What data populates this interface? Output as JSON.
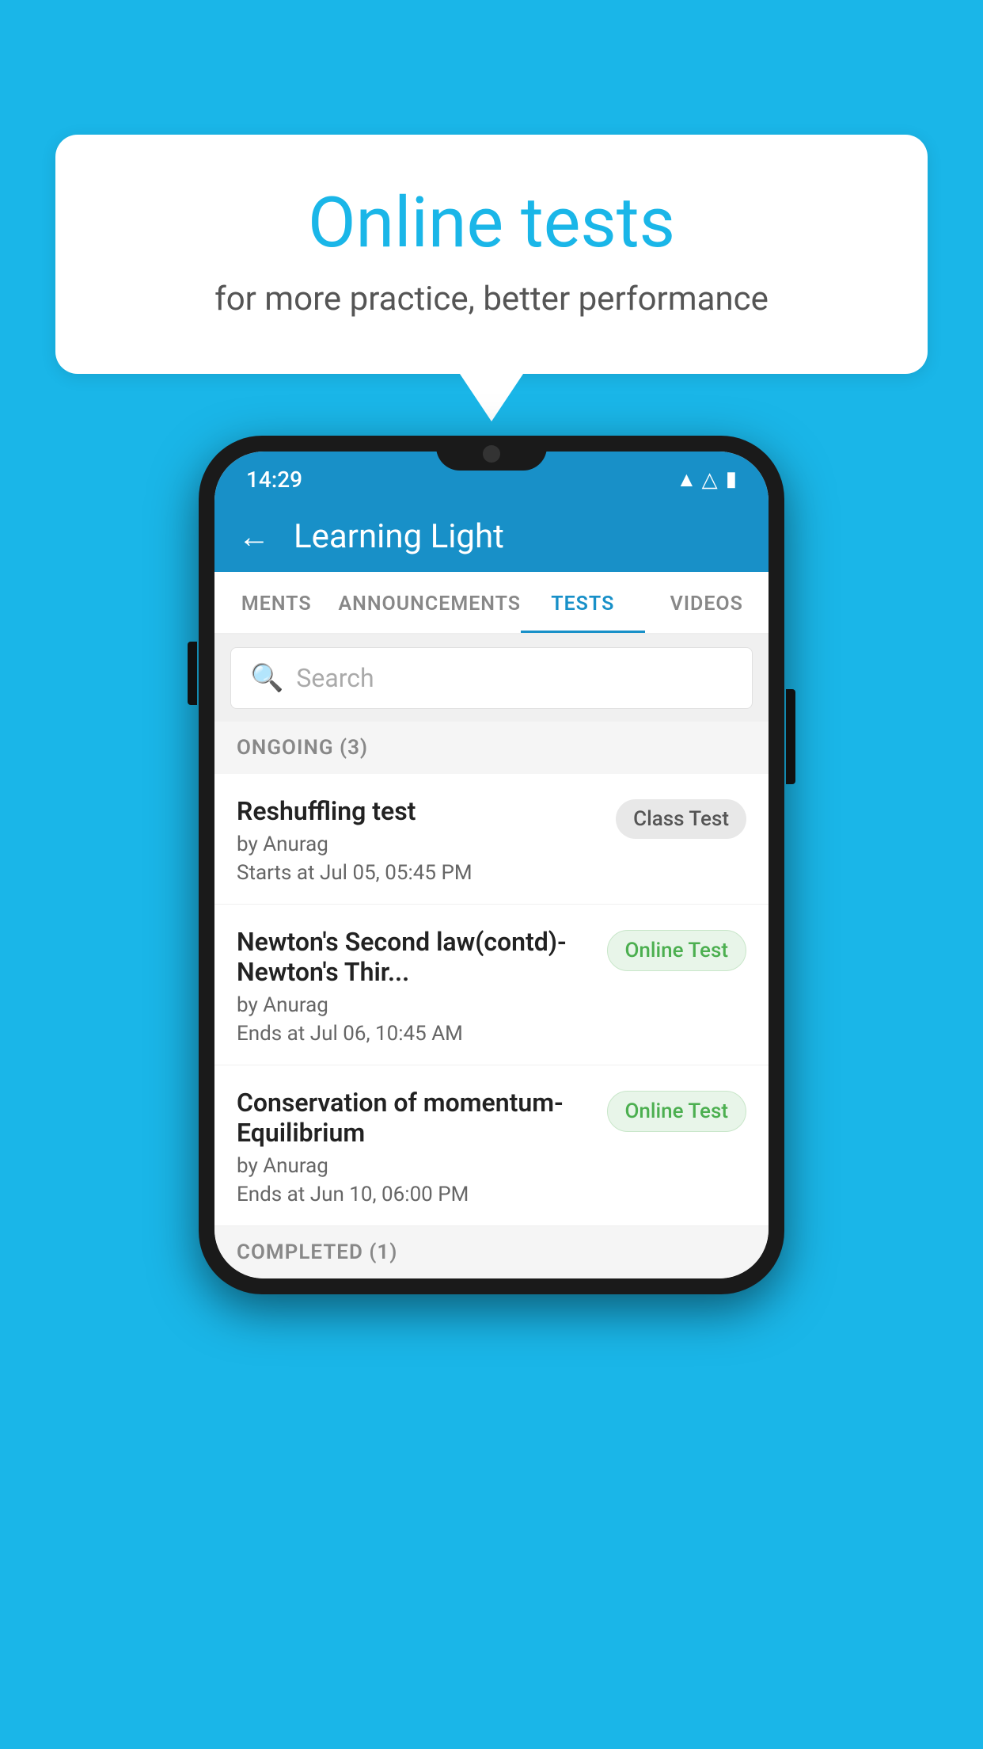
{
  "background_color": "#1ab6e8",
  "speech_bubble": {
    "title": "Online tests",
    "subtitle": "for more practice, better performance"
  },
  "phone": {
    "status_bar": {
      "time": "14:29",
      "wifi": "▾",
      "signal": "▲",
      "battery": "▮"
    },
    "header": {
      "back_label": "←",
      "title": "Learning Light"
    },
    "tabs": [
      {
        "label": "MENTS",
        "active": false
      },
      {
        "label": "ANNOUNCEMENTS",
        "active": false
      },
      {
        "label": "TESTS",
        "active": true
      },
      {
        "label": "VIDEOS",
        "active": false
      }
    ],
    "search": {
      "placeholder": "Search"
    },
    "sections": [
      {
        "label": "ONGOING (3)",
        "items": [
          {
            "name": "Reshuffling test",
            "author": "by Anurag",
            "date": "Starts at  Jul 05, 05:45 PM",
            "badge": "Class Test",
            "badge_type": "class"
          },
          {
            "name": "Newton's Second law(contd)-Newton's Thir...",
            "author": "by Anurag",
            "date": "Ends at  Jul 06, 10:45 AM",
            "badge": "Online Test",
            "badge_type": "online"
          },
          {
            "name": "Conservation of momentum-Equilibrium",
            "author": "by Anurag",
            "date": "Ends at  Jun 10, 06:00 PM",
            "badge": "Online Test",
            "badge_type": "online"
          }
        ]
      }
    ],
    "completed_section": {
      "label": "COMPLETED (1)"
    }
  }
}
